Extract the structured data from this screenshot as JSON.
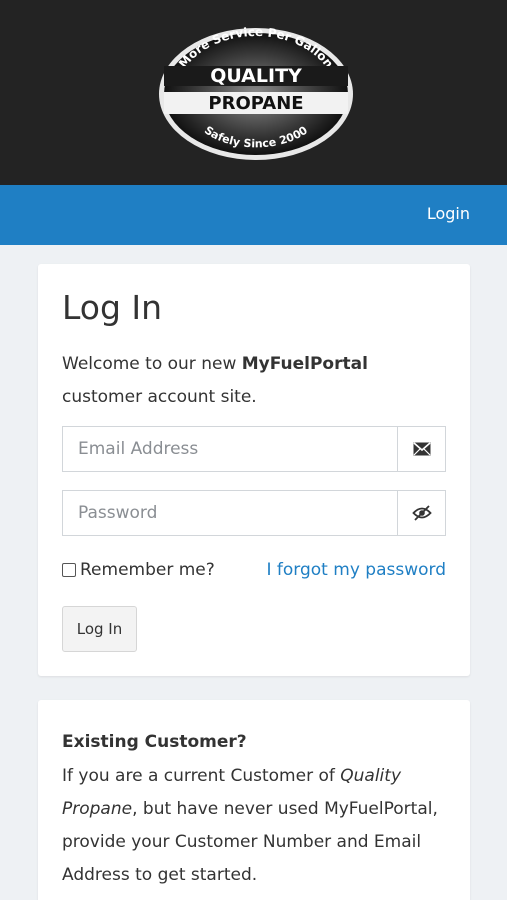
{
  "brand": {
    "logo_arc_top": "More Service Per Gallon",
    "logo_word1": "QUALITY",
    "logo_word2": "PROPANE",
    "logo_arc_bottom": "Safely Since 2000"
  },
  "nav": {
    "login_label": "Login"
  },
  "login_card": {
    "title": "Log In",
    "welcome_prefix": "Welcome to our new ",
    "welcome_brand": "MyFuelPortal",
    "welcome_suffix": " customer account site.",
    "email_placeholder": "Email Address",
    "email_icon": "envelope-icon",
    "password_placeholder": "Password",
    "password_icon": "eye-slash-icon",
    "remember_label": "Remember me?",
    "forgot_label": "I forgot my password",
    "submit_label": "Log In"
  },
  "existing_card": {
    "title": "Existing Customer?",
    "text_1": "If you are a current Customer of ",
    "text_company": "Quality Propane",
    "text_2": ", but have never used MyFuelPortal, provide your Customer Number and Email Address to get started."
  },
  "colors": {
    "brand_bar": "#232323",
    "nav_bar": "#1f7fc4",
    "link": "#1f7fc4",
    "page_bg": "#eef1f4"
  }
}
